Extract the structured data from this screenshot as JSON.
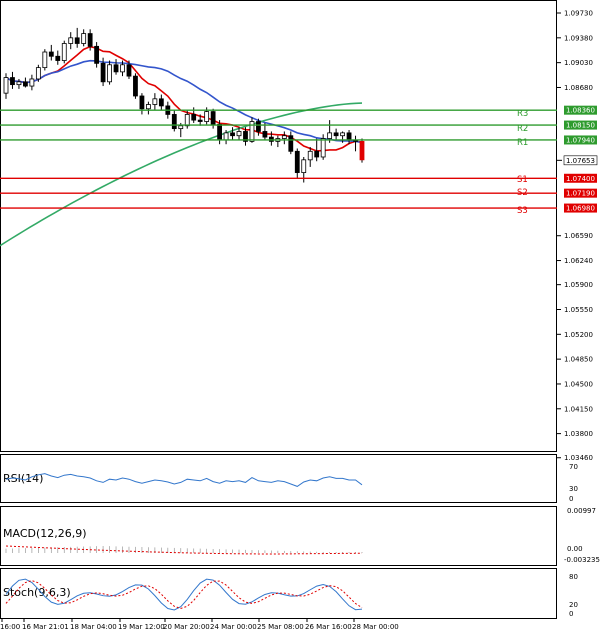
{
  "chart_data": {
    "type": "candlestick",
    "price_axis": {
      "ticks": [
        "1.09730",
        "1.09380",
        "1.09030",
        "1.08680",
        "1.08360",
        "1.08150",
        "1.07940",
        "1.07653",
        "1.07400",
        "1.07190",
        "1.06980",
        "1.06590",
        "1.06240",
        "1.05900",
        "1.05550",
        "1.05200",
        "1.04850",
        "1.04500",
        "1.04150",
        "1.03800",
        "1.03460"
      ],
      "range": [
        1.033,
        1.099
      ]
    },
    "current_price": "1.07653",
    "levels": [
      {
        "name": "R3",
        "value": 1.0836,
        "label": "1.08360",
        "color": "#2e9b2e"
      },
      {
        "name": "R2",
        "value": 1.0815,
        "label": "1.08150",
        "color": "#2e9b2e"
      },
      {
        "name": "R1",
        "value": 1.0794,
        "label": "1.07940",
        "color": "#2e9b2e"
      },
      {
        "name": "S1",
        "value": 1.074,
        "label": "1.07400",
        "color": "#e00000"
      },
      {
        "name": "S2",
        "value": 1.0719,
        "label": "1.07190",
        "color": "#e00000"
      },
      {
        "name": "S3",
        "value": 1.0698,
        "label": "1.06980",
        "color": "#e00000"
      }
    ],
    "x_labels": [
      "16:00",
      "16 Mar 21:01",
      "18 Mar 04:00",
      "19 Mar 12:00",
      "20 Mar 20:00",
      "24 Mar 00:00",
      "25 Mar 08:00",
      "26 Mar 16:00",
      "28 Mar 00:00"
    ],
    "candles": [
      [
        1.086,
        1.0888,
        1.0852,
        1.0882
      ],
      [
        1.0882,
        1.089,
        1.0866,
        1.0872
      ],
      [
        1.0872,
        1.088,
        1.0866,
        1.0876
      ],
      [
        1.0876,
        1.0882,
        1.0868,
        1.087
      ],
      [
        1.087,
        1.0886,
        1.0864,
        1.088
      ],
      [
        1.088,
        1.09,
        1.0876,
        1.0896
      ],
      [
        1.0896,
        1.0922,
        1.0892,
        1.0918
      ],
      [
        1.0918,
        1.0928,
        1.0906,
        1.0912
      ],
      [
        1.0912,
        1.092,
        1.09,
        1.0906
      ],
      [
        1.0906,
        1.0934,
        1.0902,
        1.093
      ],
      [
        1.093,
        1.0946,
        1.0922,
        1.0938
      ],
      [
        1.0938,
        1.0952,
        1.0924,
        1.093
      ],
      [
        1.093,
        1.095,
        1.0926,
        1.0944
      ],
      [
        1.0944,
        1.095,
        1.092,
        1.0926
      ],
      [
        1.0926,
        1.0932,
        1.0896,
        1.0902
      ],
      [
        1.0902,
        1.091,
        1.087,
        1.0876
      ],
      [
        1.0876,
        1.0906,
        1.0872,
        1.09
      ],
      [
        1.09,
        1.0908,
        1.0886,
        1.089
      ],
      [
        1.089,
        1.0906,
        1.0884,
        1.09
      ],
      [
        1.09,
        1.0906,
        1.088,
        1.0884
      ],
      [
        1.0884,
        1.0888,
        1.0852,
        1.0856
      ],
      [
        1.0856,
        1.086,
        1.083,
        1.0838
      ],
      [
        1.0838,
        1.0848,
        1.083,
        1.0844
      ],
      [
        1.0844,
        1.086,
        1.0836,
        1.0852
      ],
      [
        1.0852,
        1.0858,
        1.0836,
        1.0842
      ],
      [
        1.0842,
        1.0848,
        1.0824,
        1.083
      ],
      [
        1.083,
        1.0836,
        1.0806,
        1.081
      ],
      [
        1.081,
        1.0818,
        1.0798,
        1.0814
      ],
      [
        1.0814,
        1.0836,
        1.081,
        1.083
      ],
      [
        1.083,
        1.084,
        1.0818,
        1.0822
      ],
      [
        1.0822,
        1.083,
        1.0814,
        1.082
      ],
      [
        1.082,
        1.084,
        1.0816,
        1.0834
      ],
      [
        1.0834,
        1.0838,
        1.081,
        1.0816
      ],
      [
        1.0816,
        1.0822,
        1.0788,
        1.0794
      ],
      [
        1.0794,
        1.0808,
        1.0788,
        1.0804
      ],
      [
        1.0804,
        1.0812,
        1.0794,
        1.08
      ],
      [
        1.08,
        1.0812,
        1.0794,
        1.0806
      ],
      [
        1.0806,
        1.0812,
        1.0786,
        1.0792
      ],
      [
        1.0792,
        1.0826,
        1.079,
        1.082
      ],
      [
        1.082,
        1.0824,
        1.08,
        1.0806
      ],
      [
        1.0806,
        1.0818,
        1.0794,
        1.0798
      ],
      [
        1.0798,
        1.0806,
        1.0786,
        1.0792
      ],
      [
        1.0792,
        1.08,
        1.0784,
        1.0796
      ],
      [
        1.0796,
        1.0806,
        1.0788,
        1.08
      ],
      [
        1.08,
        1.0806,
        1.0774,
        1.0778
      ],
      [
        1.0778,
        1.0782,
        1.074,
        1.0748
      ],
      [
        1.0748,
        1.077,
        1.0734,
        1.0766
      ],
      [
        1.0766,
        1.0784,
        1.0756,
        1.0778
      ],
      [
        1.0778,
        1.0796,
        1.0764,
        1.077
      ],
      [
        1.077,
        1.0802,
        1.0766,
        1.0796
      ],
      [
        1.0796,
        1.0822,
        1.079,
        1.0804
      ],
      [
        1.0804,
        1.081,
        1.0794,
        1.08
      ],
      [
        1.08,
        1.0806,
        1.079,
        1.0804
      ],
      [
        1.0804,
        1.0808,
        1.0788,
        1.0794
      ],
      [
        1.0794,
        1.08,
        1.0778,
        1.0792
      ],
      [
        1.0792,
        1.0796,
        1.0762,
        1.0766
      ]
    ],
    "moving_averages": [
      {
        "color": "#e00000"
      },
      {
        "color": "#3355cc"
      },
      {
        "color": "#33aa66"
      }
    ],
    "indicators": [
      {
        "name": "RSI(14)",
        "axis": [
          "70",
          "30",
          "0"
        ],
        "values": [
          52,
          55,
          53,
          50,
          58,
          63,
          66,
          60,
          56,
          62,
          64,
          60,
          58,
          55,
          48,
          44,
          52,
          50,
          55,
          52,
          46,
          42,
          46,
          50,
          48,
          45,
          40,
          44,
          52,
          50,
          48,
          54,
          46,
          42,
          48,
          46,
          48,
          44,
          56,
          48,
          46,
          44,
          48,
          46,
          40,
          34,
          45,
          50,
          48,
          55,
          58,
          54,
          54,
          50,
          50,
          38
        ]
      },
      {
        "name": "MACD(12,26,9)",
        "axis": [
          "0.00997",
          "0.00",
          "-0.003235"
        ]
      },
      {
        "name": "Stoch(9,6,3)",
        "axis": [
          "80",
          "20",
          "0"
        ]
      }
    ]
  }
}
